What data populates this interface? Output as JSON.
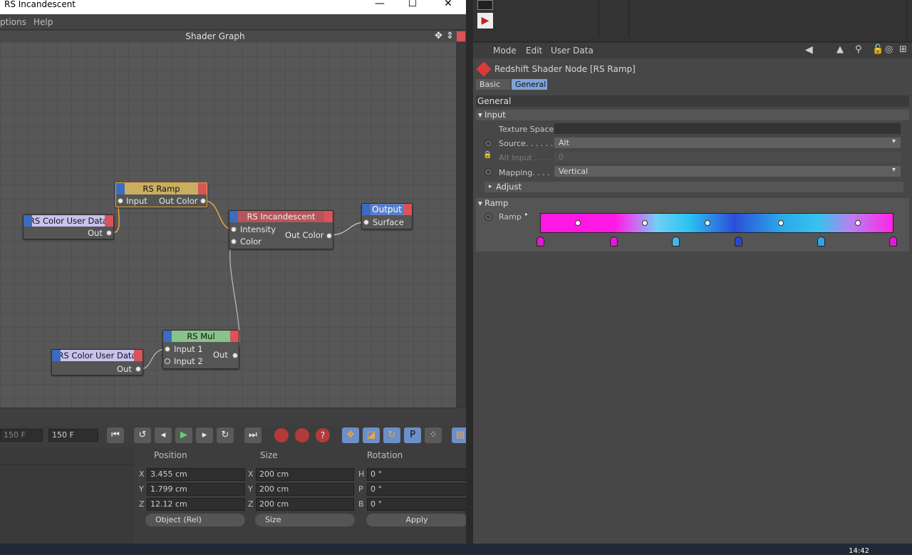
{
  "window": {
    "title": "RS Incandescent",
    "minimize": "—",
    "maximize": "☐",
    "close": "✕"
  },
  "menu": {
    "items": [
      "ptions",
      "Help"
    ]
  },
  "graph": {
    "title": "Shader Graph",
    "nodes": {
      "ramp": {
        "title": "RS Ramp",
        "input": "Input",
        "output": "Out Color"
      },
      "color_user_1": {
        "title": "RS Color User Data",
        "output": "Out"
      },
      "incandescent": {
        "title": "RS Incandescent",
        "input1": "Intensity",
        "input2": "Color",
        "output": "Out Color"
      },
      "output": {
        "title": "Output",
        "input": "Surface"
      },
      "mul": {
        "title": "RS Mul",
        "input1": "Input 1",
        "input2": "Input 2",
        "output": "Out"
      },
      "color_user_2": {
        "title": "RS Color User Data",
        "output": "Out"
      }
    },
    "node_colors": {
      "ramp": "#c9ae62",
      "color_user": "#c7c3ee",
      "incandescent": "#b5555a",
      "output": "#5a7fc7",
      "mul": "#8ac28a"
    }
  },
  "timeline": {
    "frame_end_dim": "150 F",
    "frame_field": "150 F"
  },
  "coords": {
    "headers": {
      "position": "Position",
      "size": "Size",
      "rotation": "Rotation"
    },
    "rows": [
      {
        "axis": "X",
        "pos": "3.455 cm",
        "saxis": "X",
        "size": "200 cm",
        "raxis": "H",
        "rot": "0 °"
      },
      {
        "axis": "Y",
        "pos": "1.799 cm",
        "saxis": "Y",
        "size": "200 cm",
        "raxis": "P",
        "rot": "0 °"
      },
      {
        "axis": "Z",
        "pos": "12.12 cm",
        "saxis": "Z",
        "size": "200 cm",
        "raxis": "B",
        "rot": "0 °"
      }
    ],
    "mode_dropdown": "Object (Rel)",
    "size_dropdown": "Size",
    "apply": "Apply"
  },
  "attributes": {
    "toolbar": {
      "mode": "Mode",
      "edit": "Edit",
      "user_data": "User Data"
    },
    "node_title": "Redshift Shader Node [RS Ramp]",
    "tabs": {
      "basic": "Basic",
      "general": "General"
    },
    "section": "General",
    "input_group": "Input",
    "texture_space_label": "Texture Space",
    "source_label": "Source. . . . . .",
    "source_value": "Alt",
    "alt_input_label": "Alt Input . . . .",
    "alt_input_value": "0",
    "mapping_label": "Mapping. . . .",
    "mapping_value": "Vertical",
    "adjust_group": "Adjust",
    "ramp_group": "Ramp",
    "ramp_label": "Ramp",
    "ramp_knot_colors": [
      "#e516d8",
      "#e516d8",
      "#3fb7e8",
      "#2f46c9",
      "#2aa6e6",
      "#e516d8"
    ]
  },
  "taskbar": {
    "clock": "14:42"
  }
}
